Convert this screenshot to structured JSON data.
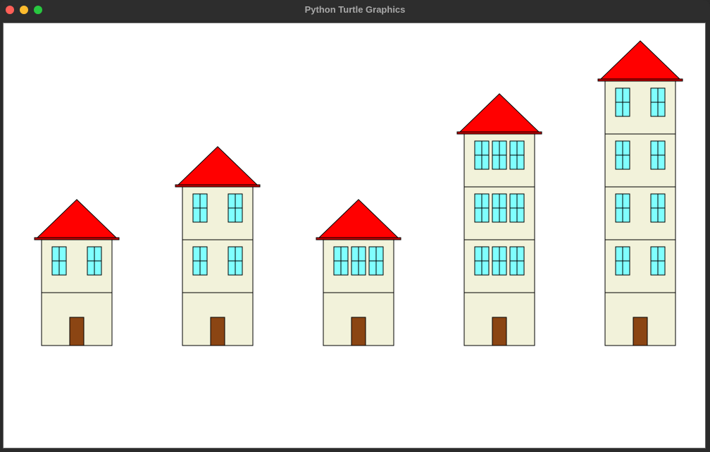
{
  "window": {
    "title": "Python Turtle Graphics",
    "colors": {
      "close": "#ff5f57",
      "minimize": "#febc2e",
      "maximize": "#28c840"
    }
  },
  "drawing": {
    "colors": {
      "wall": "#f2f2da",
      "outline": "#000000",
      "window": "#80ffff",
      "door": "#8b4513",
      "roof": "#ff0000",
      "roof_base": "#cc0000"
    },
    "houses": [
      {
        "floors": 2,
        "windows_per_floor": 2
      },
      {
        "floors": 3,
        "windows_per_floor": 2
      },
      {
        "floors": 2,
        "windows_per_floor": 3
      },
      {
        "floors": 4,
        "windows_per_floor": 3
      },
      {
        "floors": 5,
        "windows_per_floor": 2
      }
    ]
  }
}
